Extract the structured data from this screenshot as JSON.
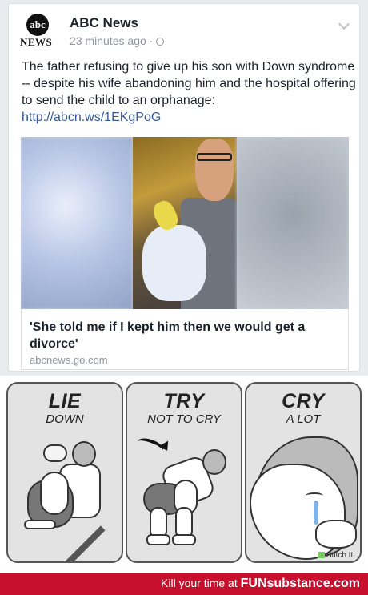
{
  "post": {
    "logo_mark": "abc",
    "logo_label": "NEWS",
    "page_name": "ABC News",
    "timestamp": "23 minutes ago ·",
    "caption": "The father refusing to give up his son with Down syndrome -- despite his wife abandoning him and the hospital offering to send the child to an orphanage:",
    "link": "http://abcn.ws/1EKgPoG",
    "headline": "'She told me if I kept him then we would get a divorce'",
    "domain": "abcnews.go.com"
  },
  "comic": {
    "panels": [
      {
        "title": "LIE",
        "subtitle": "DOWN"
      },
      {
        "title": "TRY",
        "subtitle": "NOT TO CRY"
      },
      {
        "title": "CRY",
        "subtitle": "A LOT"
      }
    ],
    "watermark": "Stitch It!"
  },
  "footer": {
    "prefix": "Kill your time at",
    "brand": "FUNsubstance.com"
  },
  "colors": {
    "link": "#365899",
    "footer_bg": "#c8102e"
  }
}
